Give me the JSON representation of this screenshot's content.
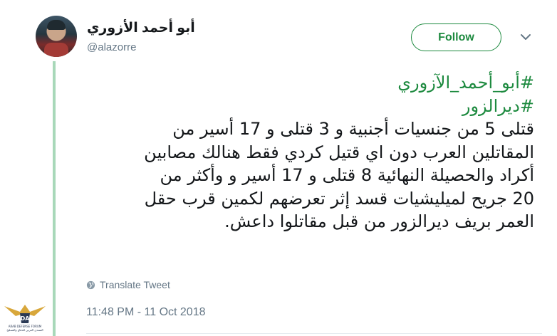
{
  "user": {
    "display_name": "أبو أحمد الأزوري",
    "username": "@alazorre"
  },
  "actions": {
    "follow_label": "Follow"
  },
  "tweet": {
    "hashtags": [
      "#أبو_أحمد_الآزوري",
      "#ديرالزور"
    ],
    "lines": [
      "قتلى 5 من جنسيات أجنبية و 3 قتلى و 17 أسير من",
      "المقاتلين العرب دون اي قتيل كردي فقط هنالك مصابين",
      "أكراد والحصيلة النهائية 8 قتلى و 17 أسير و وأكثر من",
      "20 جريح لميليشيات قسد إثر تعرضهم لكمين قرب حقل",
      "العمر بريف ديرالزور من قبل مقاتلوا داعش."
    ],
    "translate_label": "Translate Tweet",
    "timestamp": "11:48 PM - 11 Oct 2018"
  },
  "watermark": {
    "abbr": "DA",
    "line1": "ARAB DEFENSE FORUM",
    "line2": "المنتدى العربي للدفاع والتسليح"
  },
  "colors": {
    "accent": "#1d8a3f",
    "thread_line": "#a8d8b9",
    "muted": "#657786"
  }
}
